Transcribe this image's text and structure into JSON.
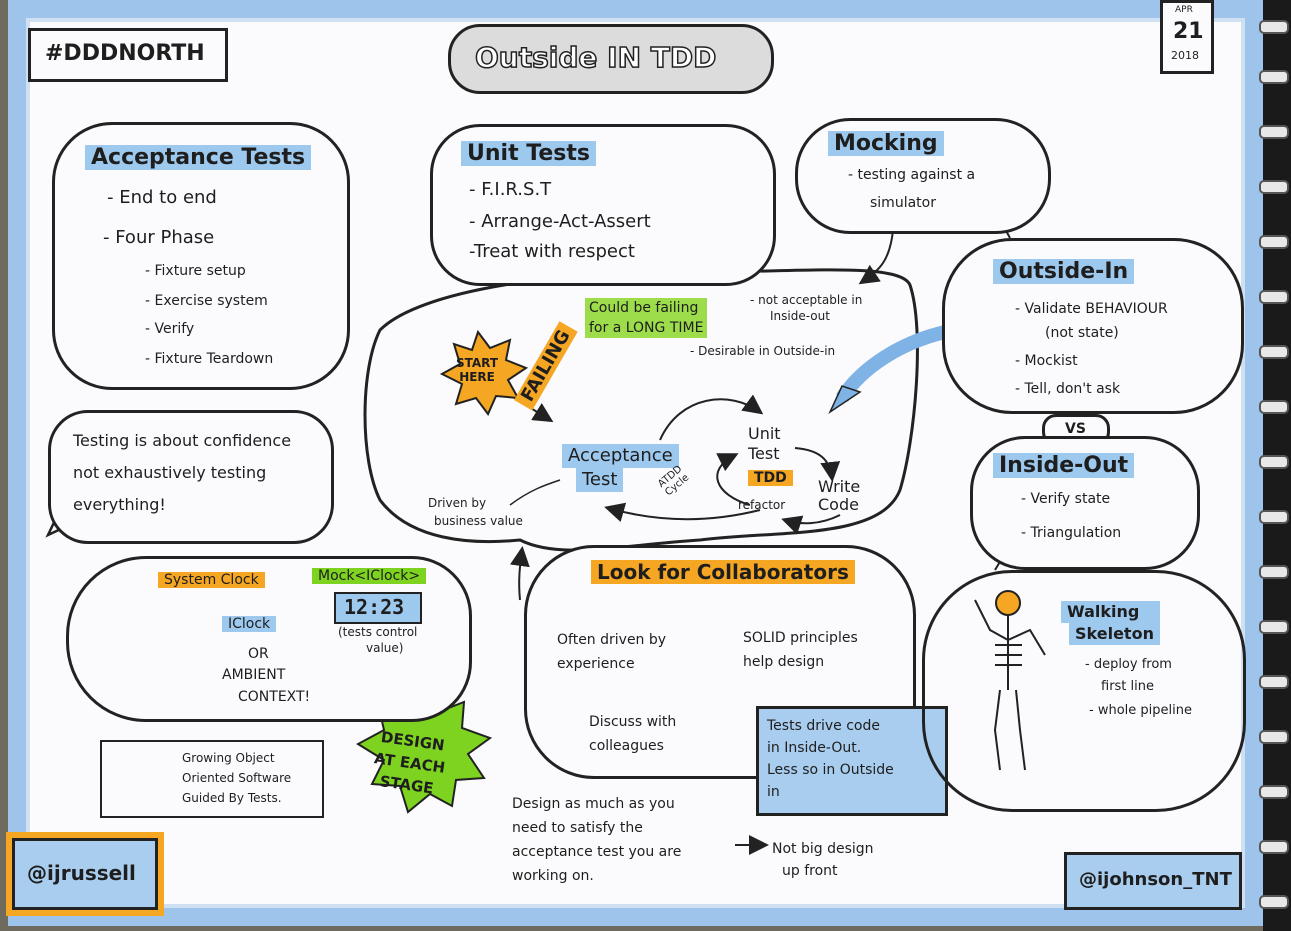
{
  "hashtag": "#DDDNORTH",
  "title": "Outside IN TDD",
  "date": {
    "month": "APR",
    "day": "21",
    "year": "2018"
  },
  "acceptance": {
    "title": "Acceptance Tests",
    "items": [
      "- End to end",
      "- Four Phase"
    ],
    "phases": [
      "- Fixture setup",
      "- Exercise system",
      "- Verify",
      "- Fixture Teardown"
    ]
  },
  "unit": {
    "title": "Unit Tests",
    "items": [
      "- F.I.R.S.T",
      "- Arrange-Act-Assert",
      "-Treat with respect"
    ]
  },
  "mocking": {
    "title": "Mocking",
    "desc1": "- testing against a",
    "desc2": "simulator"
  },
  "outside_in": {
    "title": "Outside-In",
    "items": [
      "- Validate BEHAVIOUR",
      "(not state)",
      "- Mockist",
      "- Tell, don't ask"
    ]
  },
  "vs": "VS",
  "inside_out": {
    "title": "Inside-Out",
    "items": [
      "- Verify state",
      "- Triangulation"
    ]
  },
  "confidence": [
    "Testing is about confidence",
    "not exhaustively testing",
    "everything!"
  ],
  "cycle": {
    "start": [
      "START",
      "HERE"
    ],
    "failing_note": [
      "Could be failing",
      "for a LONG TIME"
    ],
    "not_acceptable": [
      "- not acceptable in",
      "Inside-out"
    ],
    "desirable": "- Desirable in Outside-in",
    "failing": "FAILING",
    "acceptance": [
      "Acceptance",
      "Test"
    ],
    "atdd": [
      "ATDD",
      "Cycle"
    ],
    "unit": [
      "Unit",
      "Test"
    ],
    "tdd": "TDD",
    "write": [
      "Write",
      "Code"
    ],
    "refactor": "refactor",
    "driven": [
      "Driven by",
      "business value"
    ]
  },
  "clock": {
    "system": "System Clock",
    "mock": "Mock<IClock>",
    "iclock": "IClock",
    "display": "12:23",
    "control": [
      "(tests control",
      "value)"
    ],
    "or": "OR",
    "ambient": [
      "AMBIENT",
      "CONTEXT!"
    ]
  },
  "collab": {
    "title": "Look for Collaborators",
    "often": [
      "Often driven by",
      "experience"
    ],
    "solid": [
      "SOLID principles",
      "help design"
    ],
    "discuss": [
      "Discuss with",
      "colleagues"
    ]
  },
  "tests_drive": [
    "Tests drive code",
    "in Inside-Out.",
    "Less so in Outside",
    "in"
  ],
  "walking": {
    "title": [
      "Walking",
      "Skeleton"
    ],
    "items": [
      "- deploy from",
      "first line",
      "- whole pipeline"
    ]
  },
  "book": [
    "Growing Object",
    "Oriented Software",
    "Guided By Tests."
  ],
  "design_stage": [
    "DESIGN",
    "AT EACH",
    "STAGE"
  ],
  "design_note": [
    "Design as much as you",
    "need to satisfy the",
    "acceptance test you are",
    "working on."
  ],
  "big_design": [
    "Not big design",
    "up front"
  ],
  "author_left": "@ijrussell",
  "author_right": "@ijohnson_TNT"
}
